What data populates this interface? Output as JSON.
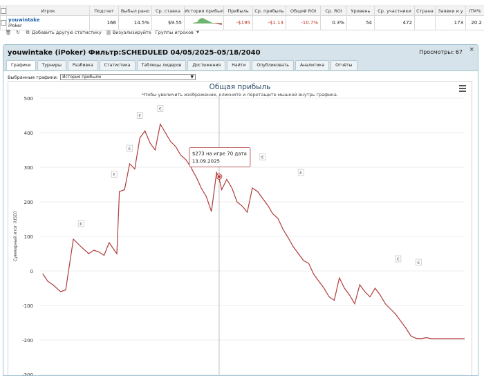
{
  "table": {
    "headers": [
      "Игрок",
      "Подсчет",
      "Выбыл рано",
      "Ср. ставка",
      "История прибыл",
      "Прибыль",
      "Ср. прибыль",
      "Общий ROI",
      "Ср. ROI",
      "Уровень",
      "Ср. участники",
      "Страна",
      "Заявки и у",
      "ITM%"
    ],
    "row": {
      "player_name": "youwintake",
      "player_network": "iPoker",
      "count": "166",
      "early_out": "14.5%",
      "avg_stake": "$9.55",
      "profit": "-$195",
      "avg_profit": "-$1.13",
      "total_roi": "-10.7%",
      "avg_roi": "0.3%",
      "level": "54",
      "avg_entrants": "472",
      "country": "",
      "entries": "173",
      "itm": "20.2"
    }
  },
  "toolbar": {
    "add_stats": "Добавить другую статистику",
    "visualize": "Визуализируйте",
    "player_groups": "Группы игроков"
  },
  "panel": {
    "title": "youwintake (iPoker) Фильтр:SCHEDULED 04/05/2025-05/18/2040",
    "views": "Просмотры: 67",
    "close": "×",
    "tabs": [
      "Графики",
      "Турниры",
      "Разбивка",
      "Статистика",
      "Таблицы лидеров",
      "Достижения",
      "Найти",
      "Опубликовать",
      "Аналитика",
      "Отчёты"
    ]
  },
  "graph_select": {
    "label": "Выбранные графики:",
    "value": "История прибыли"
  },
  "chart_data": {
    "type": "line",
    "title": "Общая прибыль",
    "subtitle": "Чтобы увеличить изображение, кликните и перетащите мышкой внутрь графика.",
    "ylabel": "Суммарный итог (USD)",
    "ylim": [
      -300,
      500
    ],
    "yticks": [
      -300,
      -200,
      -100,
      0,
      100,
      200,
      300,
      400,
      500
    ],
    "grid": true,
    "series_color": "#b03a3a",
    "tooltip": {
      "line1": "$273 на игре 70 дата",
      "line2": "13.09.2025",
      "game": 70,
      "value": 273
    },
    "x": [
      1,
      3,
      5,
      8,
      10,
      13,
      16,
      19,
      21,
      23,
      25,
      27,
      29,
      30,
      31,
      33,
      35,
      37,
      39,
      41,
      43,
      45,
      47,
      49,
      51,
      53,
      55,
      57,
      59,
      60,
      61,
      63,
      65,
      67,
      69,
      70,
      71,
      73,
      75,
      77,
      79,
      81,
      83,
      85,
      87,
      89,
      91,
      93,
      95,
      97,
      99,
      101,
      103,
      105,
      107,
      109,
      111,
      113,
      115,
      117,
      119,
      121,
      123,
      125,
      127,
      129,
      131,
      133,
      135,
      137,
      139,
      141,
      143,
      145,
      147,
      149,
      151,
      153,
      155,
      157,
      159,
      161,
      163,
      165,
      166
    ],
    "values": [
      -8,
      -30,
      -40,
      -60,
      -55,
      92,
      70,
      50,
      60,
      55,
      45,
      82,
      60,
      50,
      230,
      235,
      310,
      295,
      385,
      405,
      370,
      350,
      425,
      400,
      375,
      360,
      335,
      322,
      300,
      285,
      273,
      240,
      215,
      172,
      285,
      268,
      235,
      265,
      240,
      200,
      188,
      170,
      240,
      230,
      210,
      190,
      165,
      152,
      120,
      96,
      70,
      50,
      30,
      22,
      -10,
      -30,
      -50,
      -75,
      -85,
      -20,
      -50,
      -70,
      -95,
      -40,
      -60,
      -75,
      -50,
      -70,
      -95,
      -110,
      -125,
      -145,
      -165,
      -188,
      -195,
      -196,
      -193,
      -196,
      -196,
      -196,
      -196,
      -196,
      -196,
      -196,
      -196
    ],
    "markers": [
      {
        "x": 16,
        "y": 92,
        "label": "€"
      },
      {
        "x": 29,
        "y": 235,
        "label": "€"
      },
      {
        "x": 35,
        "y": 310,
        "label": "€"
      },
      {
        "x": 39,
        "y": 405,
        "label": "€"
      },
      {
        "x": 47,
        "y": 425,
        "label": "€"
      },
      {
        "x": 87,
        "y": 285,
        "label": "€"
      },
      {
        "x": 102,
        "y": 240,
        "label": "€"
      },
      {
        "x": 140,
        "y": -10,
        "label": "€"
      },
      {
        "x": 148,
        "y": -20,
        "label": "€"
      }
    ]
  }
}
